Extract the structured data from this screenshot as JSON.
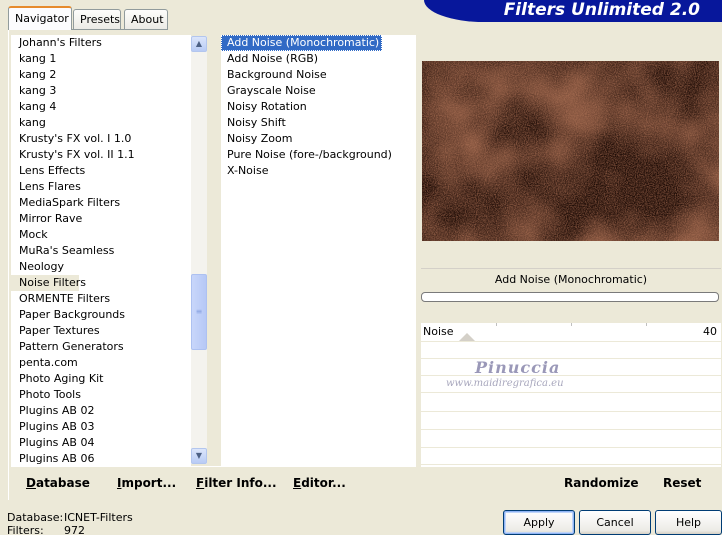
{
  "tabs": [
    {
      "label": "Navigator",
      "active": true
    },
    {
      "label": "Presets",
      "active": false
    },
    {
      "label": "About",
      "active": false
    }
  ],
  "app_title": "Filters Unlimited 2.0",
  "categories": [
    "Johann's Filters",
    "kang 1",
    "kang 2",
    "kang 3",
    "kang 4",
    "kang",
    "Krusty's FX vol. I 1.0",
    "Krusty's FX vol. II 1.1",
    "Lens Effects",
    "Lens Flares",
    "MediaSpark Filters",
    "Mirror Rave",
    "Mock",
    "MuRa's Seamless",
    "Neology",
    "Noise Filters",
    "ORMENTE Filters",
    "Paper Backgrounds",
    "Paper Textures",
    "Pattern Generators",
    "penta.com",
    "Photo Aging Kit",
    "Photo Tools",
    "Plugins AB 02",
    "Plugins AB 03",
    "Plugins AB 04",
    "Plugins AB 06"
  ],
  "selected_category_index": 15,
  "filters": [
    "Add Noise (Monochromatic)",
    "Add Noise (RGB)",
    "Background Noise",
    "Grayscale Noise",
    "Noisy Rotation",
    "Noisy Shift",
    "Noisy Zoom",
    "Pure Noise (fore-/background)",
    "X-Noise"
  ],
  "selected_filter_index": 0,
  "bottom_buttons": {
    "database": "Database",
    "import": "Import...",
    "filter_info": "Filter Info...",
    "editor": "Editor...",
    "randomize": "Randomize",
    "reset": "Reset"
  },
  "preview_filter_name": "Add Noise (Monochromatic)",
  "progress": 0,
  "param": {
    "label": "Noise",
    "value": "40"
  },
  "watermark": {
    "line1": "Pinuccia",
    "line2": "www.maidiregrafica.eu"
  },
  "status": {
    "database_label": "Database:",
    "database_value": "ICNET-Filters",
    "filters_label": "Filters:",
    "filters_value": "972"
  },
  "dialog_buttons": {
    "apply": "Apply",
    "cancel": "Cancel",
    "help": "Help"
  },
  "icons": {
    "scroll_up": "chevron-up-icon",
    "scroll_down": "chevron-down-icon",
    "thumb": "grip-icon"
  },
  "colors": {
    "title_bg": "#07179b",
    "selection": "#316ac5",
    "preview": "#2b1209"
  }
}
